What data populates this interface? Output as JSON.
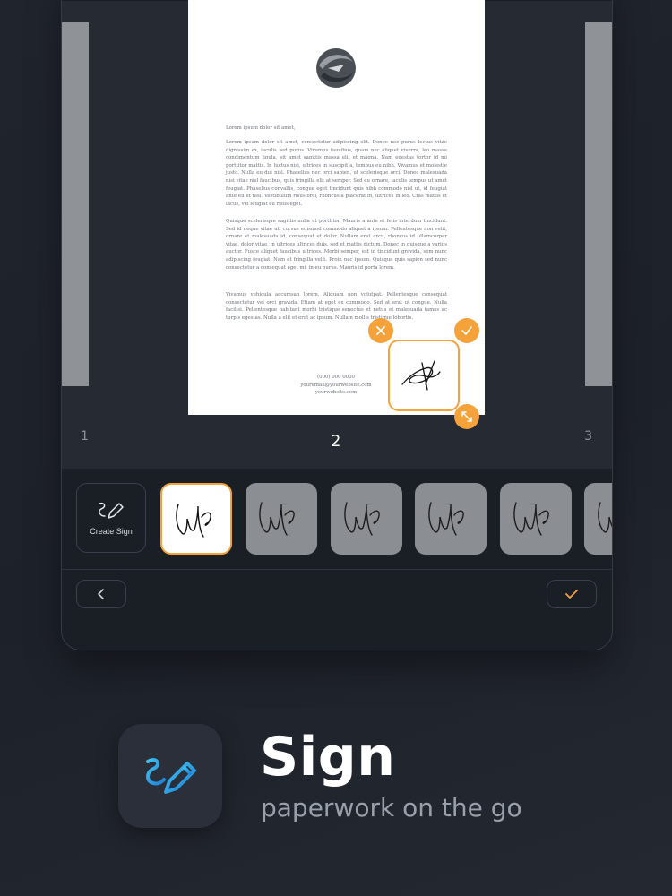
{
  "document": {
    "greeting": "Lorem ipsum dolor sit amet,",
    "paragraphs": [
      "Lorem ipsum dolor sit amet, consectetur adipiscing elit. Donec nec purus lectus vitae dignissim ex, iaculis sed purus. Vivamus faucibus, quam nec aliquet viverra, leo massa condimentum ligula, sit amet sagittis massa elit et magna. Nam egestas tortor id mi porttitor mattis. In luctus nisi, ultrices in suscipit a, tempus eu nibh. Vivamus et molestie justo. Nulla eu dui nisl. Phasellus nec orci sapien, ut scelerisque orci. Donec malesuada nisi vitae nisl faucibus, quis fringilla elit at semper. Sed eu ornare, iaculis tempus ut amet feugiat. Phasellus convallis, congue eget tincidunt quis nibh commodo nisl ut, id feugiat ante eu et nisi. Vestibulum risus orci, rhoncus a placerat in, ultrices in leo. Cras mattis et lacus, vel feugiat eu risus eget.",
      "Quisque scelerisque sagittis nulla ut porttitor. Mauris a ante et felis interdum tincidunt. Sed id neque vitae uti cursus euismod commodo aliquet a ipsum. Pellentesque non velit, ornare et malesuada id, consequat et dolor. Nullam erat arcu, rhoncus id ullamcorper vitae, dolor vitae, in ultrices ultrices duis, sed et mattis dictum. Donec in quisque a varius auctor. Fusce aliquet faucibus ultrices. Morbi semper, est id tincidunt gravida, sem nunc adipiscing feugiat. Nam et fringilla velit. Proin nec ipsum. Quisque quis sapien sed nunc consectetur a consequat eget mi, in eu purus. Mauris id porta lorem.",
      "Vivamus vehicula accumsan lorem. Aliquam non volutpat. Pellentesque consequat consectetur vel orci gravida. Etiam at eget ex commodo. Sed at erat ut congue. Nulla facilisi. Pellentesque habitant morbi tristique senectus et netus et malesuada fames ac turpis egestas. Nulla a elit et erat ac ipsum. Nullam mollis tristique lobortis."
    ],
    "contact": [
      "(000) 000 0000",
      "youremail@yourwebsite.com",
      "yourwebsite.com"
    ]
  },
  "pages": {
    "prev": "1",
    "current": "2",
    "next": "3"
  },
  "tray": {
    "create_label": "Create Sign"
  },
  "signature_tiles": [
    {
      "state": "selected"
    },
    {
      "state": "default"
    },
    {
      "state": "default"
    },
    {
      "state": "default"
    },
    {
      "state": "default"
    },
    {
      "state": "partial"
    }
  ],
  "promo": {
    "title": "Sign",
    "subtitle": "paperwork on the go"
  },
  "colors": {
    "accent": "#f5a23a",
    "icon_blue": "#29a6e6",
    "background": "#1f232b"
  },
  "icons": [
    "logo-icon",
    "close-icon",
    "check-icon",
    "resize-icon",
    "pen-icon",
    "chevron-left-icon",
    "sign-pen-icon"
  ]
}
